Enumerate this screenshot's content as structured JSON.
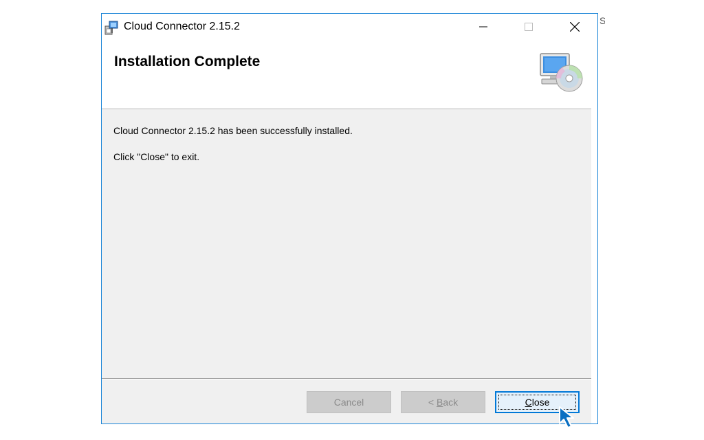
{
  "window": {
    "title": "Cloud Connector 2.15.2",
    "icons": {
      "app": "installer-icon",
      "minimize": "minimize-icon",
      "maximize": "maximize-icon",
      "close": "close-icon"
    }
  },
  "header": {
    "title": "Installation Complete",
    "icon": "computer-cd-icon"
  },
  "body": {
    "line1": "Cloud Connector 2.15.2 has been successfully installed.",
    "line2": "Click \"Close\" to exit."
  },
  "buttons": {
    "cancel": "Cancel",
    "back_arrow": "<",
    "back_accel": "B",
    "back_rest": "ack",
    "close_accel": "C",
    "close_rest": "lose"
  },
  "background_fragment": "S",
  "colors": {
    "accent": "#0078d7",
    "window_border": "#1883d7",
    "dialog_bg": "#f0f0f0",
    "disabled_button": "#cccccc"
  },
  "cursor": "pointer-cursor-icon"
}
